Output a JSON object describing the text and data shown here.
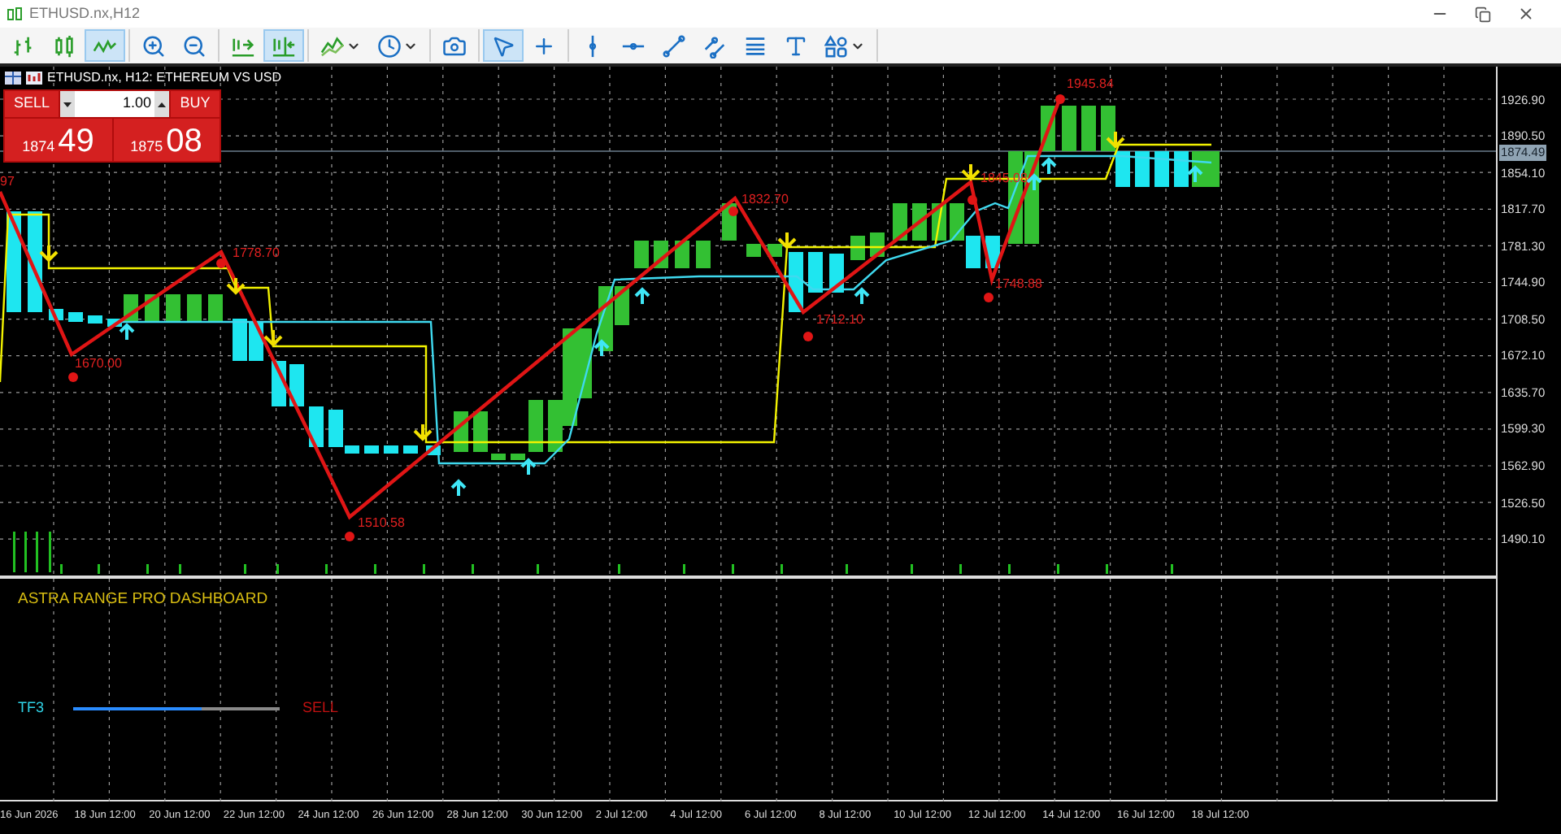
{
  "window": {
    "title": "ETHUSD.nx,H12"
  },
  "toolbar": [
    [
      {
        "kind": "bar-chart",
        "selected": false,
        "dropdown": false
      },
      {
        "kind": "candle-chart",
        "selected": false,
        "dropdown": false
      },
      {
        "kind": "line-chart",
        "selected": true,
        "dropdown": false
      }
    ],
    [
      {
        "kind": "zoom-in",
        "selected": false,
        "dropdown": false
      },
      {
        "kind": "zoom-out",
        "selected": false,
        "dropdown": false
      }
    ],
    [
      {
        "kind": "chart-shift",
        "selected": false,
        "dropdown": false
      },
      {
        "kind": "auto-scroll",
        "selected": true,
        "dropdown": false
      }
    ],
    [
      {
        "kind": "indicators",
        "selected": false,
        "dropdown": true
      },
      {
        "kind": "clock",
        "selected": false,
        "dropdown": true
      }
    ],
    [
      {
        "kind": "screenshot",
        "selected": false,
        "dropdown": false
      }
    ],
    [
      {
        "kind": "cursor",
        "selected": true,
        "dropdown": false
      },
      {
        "kind": "crosshair",
        "selected": false,
        "dropdown": false
      }
    ],
    [
      {
        "kind": "vertical-line",
        "selected": false,
        "dropdown": false
      },
      {
        "kind": "horizontal-line",
        "selected": false,
        "dropdown": false
      },
      {
        "kind": "trend-line",
        "selected": false,
        "dropdown": false
      },
      {
        "kind": "channel",
        "selected": false,
        "dropdown": false
      },
      {
        "kind": "fibonacci",
        "selected": false,
        "dropdown": false
      },
      {
        "kind": "text-tool",
        "selected": false,
        "dropdown": false
      },
      {
        "kind": "shapes",
        "selected": false,
        "dropdown": true
      }
    ]
  ],
  "chart": {
    "header": "ETHUSD.nx, H12: ETHEREUM VS USD",
    "price_axis": [
      "1926.90",
      "1890.50",
      "1854.10",
      "1817.70",
      "1781.30",
      "1744.90",
      "1708.50",
      "1672.10",
      "1635.70",
      "1599.30",
      "1562.90",
      "1526.50",
      "1490.10"
    ],
    "current_price": "1874.49",
    "zigzag_labels": [
      "97",
      "1670.00",
      "1778.70",
      "1510.58",
      "1832.70",
      "1712.10",
      "1845.08",
      "1748.88",
      "1945.84"
    ],
    "time_axis": [
      "16 Jun 2026",
      "18 Jun 12:00",
      "20 Jun 12:00",
      "22 Jun 12:00",
      "24 Jun 12:00",
      "26 Jun 12:00",
      "28 Jun 12:00",
      "30 Jun 12:00",
      "2 Jul 12:00",
      "4 Jul 12:00",
      "6 Jul 12:00",
      "8 Jul 12:00",
      "10 Jul 12:00",
      "12 Jul 12:00",
      "14 Jul 12:00",
      "16 Jul 12:00",
      "18 Jul 12:00"
    ]
  },
  "trade_panel": {
    "sell_label": "SELL",
    "buy_label": "BUY",
    "volume": "1.00",
    "sell_price": {
      "main": "1874",
      "pips": "49"
    },
    "buy_price": {
      "main": "1875",
      "pips": "08"
    }
  },
  "dashboard": {
    "title": "ASTRA RANGE PRO DASHBOARD",
    "rows": [
      {
        "label": "TF3",
        "level": 0.62,
        "signal": "SELL"
      }
    ]
  }
}
